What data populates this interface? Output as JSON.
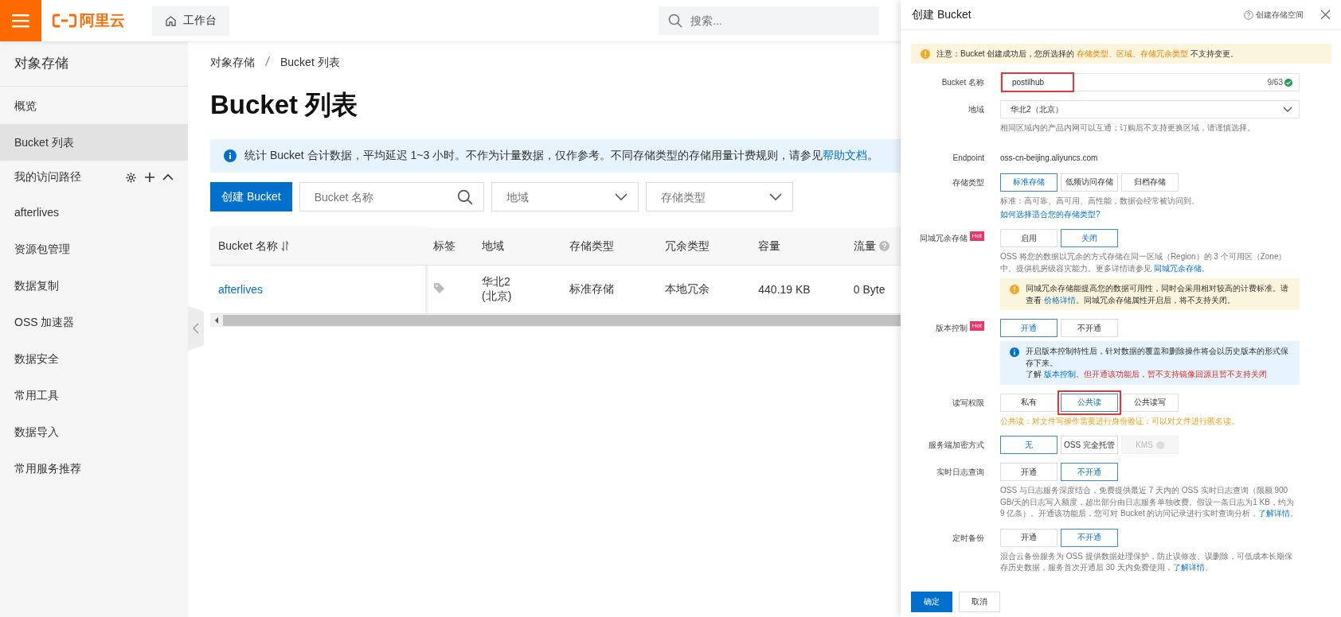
{
  "header": {
    "brand": "阿里云",
    "workbench": "工作台",
    "search": {
      "placeholder": "搜索..."
    }
  },
  "sidebar": {
    "title": "对象存储",
    "items": [
      {
        "label": "概览",
        "kind": "item",
        "selected": false
      },
      {
        "label": "Bucket 列表",
        "kind": "item",
        "selected": true
      },
      {
        "label": "我的访问路径",
        "kind": "group",
        "expanded": true,
        "children": [
          {
            "label": "afterlives",
            "selected": false
          }
        ]
      },
      {
        "label": "资源包管理",
        "kind": "item",
        "selected": false
      },
      {
        "label": "数据复制",
        "kind": "item",
        "selected": false
      },
      {
        "label": "OSS 加速器",
        "kind": "item",
        "selected": false
      },
      {
        "label": "数据安全",
        "kind": "item",
        "selected": false
      },
      {
        "label": "常用工具",
        "kind": "item",
        "selected": false
      },
      {
        "label": "数据导入",
        "kind": "item",
        "selected": false
      },
      {
        "label": "常用服务推荐",
        "kind": "item",
        "selected": false
      }
    ]
  },
  "breadcrumb": [
    "对象存储",
    "Bucket 列表"
  ],
  "page_title": "Bucket 列表",
  "banner": {
    "text": "统计 Bucket 合计数据，平均延迟 1~3 小时。不作为计量数据，仅作参考。不同存储类型的存储用量计费规则，请参见",
    "link": "帮助文档",
    "tail": "。"
  },
  "toolbar": {
    "create": "创建 Bucket",
    "name_search": {
      "placeholder": "Bucket 名称"
    },
    "region": {
      "placeholder": "地域"
    },
    "storage_type": {
      "placeholder": "存储类型"
    }
  },
  "table": {
    "columns": [
      {
        "label": "Bucket 名称",
        "sortable": true,
        "help": false
      },
      {
        "label": "标签",
        "sortable": false,
        "help": false
      },
      {
        "label": "地域",
        "sortable": false,
        "help": false
      },
      {
        "label": "存储类型",
        "sortable": false,
        "help": false
      },
      {
        "label": "冗余类型",
        "sortable": false,
        "help": false
      },
      {
        "label": "容量",
        "sortable": false,
        "help": false
      },
      {
        "label": "流量",
        "sortable": false,
        "help": true
      }
    ],
    "rows": [
      {
        "name": "afterlives",
        "region": "华北2\n(北京)",
        "storage_class": "标准存储",
        "redundancy": "本地冗余",
        "size": "440.19 KB",
        "traffic": "0 Byte"
      }
    ]
  },
  "drawer": {
    "title": "创建 Bucket",
    "help_link": "创建存储空间",
    "notice": [
      {
        "text": "注意：Bucket 创建成功后，您所选择的 ",
        "kind": "plain"
      },
      {
        "text": "存储类型、区域、存储冗余类型",
        "kind": "accent"
      },
      {
        "text": " 不支持变更。",
        "kind": "plain"
      }
    ],
    "rows": [
      {
        "kind": "input",
        "label": "Bucket 名称",
        "value": "postilhub",
        "counter": "9/63",
        "valid": true,
        "annotated": true
      },
      {
        "kind": "select",
        "label": "地域",
        "value": "华北2（北京）",
        "hint": {
          "kind": "muted",
          "parts": [
            {
              "text": "相同区域内的产品内网可以互通；订购后不支持更换区域，请谨慎选择。",
              "kind": "plain"
            }
          ]
        }
      },
      {
        "kind": "text",
        "label": "Endpoint",
        "value": "oss-cn-beijing.aliyuncs.com"
      },
      {
        "kind": "options",
        "label": "存储类型",
        "options": [
          {
            "label": "标准存储",
            "selected": true,
            "disabled": false,
            "annotated": false
          },
          {
            "label": "低频访问存储",
            "selected": false,
            "disabled": false,
            "annotated": false
          },
          {
            "label": "归档存储",
            "selected": false,
            "disabled": false,
            "annotated": false
          }
        ],
        "hint": {
          "kind": "muted",
          "parts": [
            {
              "text": "标准：高可靠、高可用、高性能，数据会经常被访问到。",
              "kind": "plain"
            }
          ]
        },
        "link": "如何选择适合您的存储类型?"
      },
      {
        "kind": "options",
        "label": "同城冗余存储",
        "hot": "Hot",
        "options": [
          {
            "label": "启用",
            "selected": false,
            "disabled": false,
            "annotated": false
          },
          {
            "label": "关闭",
            "selected": true,
            "disabled": false,
            "annotated": false
          }
        ],
        "hint": {
          "kind": "muted",
          "parts": [
            {
              "text": "OSS 将您的数据以冗余的方式存储在同一区域（Region）的 3 个可用区（Zone）中。提供机房级容灾能力。更多详情请参见 ",
              "kind": "plain"
            },
            {
              "text": "同城冗余存储",
              "kind": "link"
            },
            {
              "text": "。",
              "kind": "plain"
            }
          ]
        },
        "note": {
          "kind": "warning",
          "parts": [
            {
              "text": "同城冗余存储能提高您的数据可用性，同时会采用相对较高的计费标准。请查看 ",
              "kind": "plain"
            },
            {
              "text": "价格详情",
              "kind": "link"
            },
            {
              "text": "。同城冗余存储属性开启后，将不支持关闭。",
              "kind": "plain"
            }
          ]
        }
      },
      {
        "kind": "options",
        "label": "版本控制",
        "hot": "Hot",
        "options": [
          {
            "label": "开通",
            "selected": true,
            "disabled": false,
            "annotated": false
          },
          {
            "label": "不开通",
            "selected": false,
            "disabled": false,
            "annotated": false
          }
        ],
        "note": {
          "kind": "info",
          "parts": [
            {
              "text": "开启版本控制特性后，针对数据的覆盖和删除操作将会以历史版本的形式保存下来。",
              "kind": "plain"
            },
            {
              "kind": "break"
            },
            {
              "text": "了解 ",
              "kind": "plain"
            },
            {
              "text": "版本控制",
              "kind": "link"
            },
            {
              "text": "。但开通该功能后，暂不支持镜像回源且暂不支持关闭",
              "kind": "danger"
            }
          ]
        }
      },
      {
        "kind": "options",
        "label": "读写权限",
        "options": [
          {
            "label": "私有",
            "selected": false,
            "disabled": false,
            "annotated": false
          },
          {
            "label": "公共读",
            "selected": true,
            "disabled": false,
            "annotated": true
          },
          {
            "label": "公共读写",
            "selected": false,
            "disabled": false,
            "annotated": false
          }
        ],
        "hint": {
          "kind": "warning",
          "parts": [
            {
              "text": "公共读：对文件写操作需要进行身份验证；可以对文件进行匿名读。",
              "kind": "plain"
            }
          ]
        }
      },
      {
        "kind": "options",
        "label": "服务端加密方式",
        "options": [
          {
            "label": "无",
            "selected": true,
            "disabled": false,
            "annotated": false
          },
          {
            "label": "OSS 完全托管",
            "selected": false,
            "disabled": false,
            "annotated": false
          },
          {
            "label": "KMS",
            "selected": false,
            "disabled": true,
            "annotated": false
          }
        ]
      },
      {
        "kind": "options",
        "label": "实时日志查询",
        "options": [
          {
            "label": "开通",
            "selected": false,
            "disabled": false,
            "annotated": false
          },
          {
            "label": "不开通",
            "selected": true,
            "disabled": false,
            "annotated": false
          }
        ],
        "hint": {
          "kind": "muted",
          "parts": [
            {
              "text": "OSS 与日志服务深度结合，免费提供最近 7 天内的 OSS 实时日志查询（限额 900 GB/天的日志写入额度，超出部分由日志服务单独收费。假设一条日志为1 KB，约为 9 亿条）。开通该功能后，您可对 Bucket 的访问记录进行实时查询分析，",
              "kind": "plain"
            },
            {
              "text": "了解详情",
              "kind": "link"
            },
            {
              "text": "。",
              "kind": "plain"
            }
          ]
        }
      },
      {
        "kind": "options",
        "label": "定时备份",
        "options": [
          {
            "label": "开通",
            "selected": false,
            "disabled": false,
            "annotated": false
          },
          {
            "label": "不开通",
            "selected": true,
            "disabled": false,
            "annotated": false
          }
        ],
        "hint": {
          "kind": "muted",
          "parts": [
            {
              "text": "混合云备份服务为 OSS 提供数据处理保护，防止误修改、误删除，可低成本长期保存历史数据，服务首次开通后 30 天内免费使用，",
              "kind": "plain"
            },
            {
              "text": "了解详情",
              "kind": "link"
            },
            {
              "text": "。",
              "kind": "plain"
            }
          ]
        }
      }
    ],
    "confirm": "确定",
    "cancel": "取消"
  }
}
